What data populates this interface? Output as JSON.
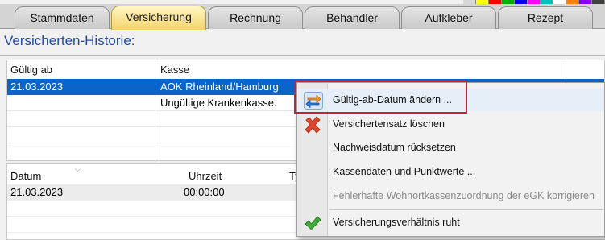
{
  "colors": {
    "accent_title": "#1f4ba8",
    "selection": "#0a64c9",
    "active_tab": "#f4d36a",
    "highlight_box": "#c0243c",
    "swatches": [
      "#d8d8d8",
      "#ffff00",
      "#ff0000",
      "#00b000",
      "#0000ff",
      "#ff00ff",
      "#00c0c0",
      "#ffffff",
      "#ff8000",
      "#8000ff",
      "#404040"
    ]
  },
  "tabs": [
    {
      "label": "Stammdaten",
      "active": false
    },
    {
      "label": "Versicherung",
      "active": true
    },
    {
      "label": "Rechnung",
      "active": false
    },
    {
      "label": "Behandler",
      "active": false
    },
    {
      "label": "Aufkleber",
      "active": false
    },
    {
      "label": "Rezept",
      "active": false
    }
  ],
  "title": "Versicherten-Historie:",
  "history_grid": {
    "columns": [
      "Gültig ab",
      "Kasse"
    ],
    "rows": [
      {
        "gueltig_ab": "21.03.2023",
        "kasse": "AOK Rheinland/Hamburg",
        "selected": true
      },
      {
        "gueltig_ab": "",
        "kasse": "Ungültige Krankenkasse.",
        "selected": false
      }
    ]
  },
  "detail_grid": {
    "columns": [
      "Datum",
      "Uhrzeit",
      "Ty"
    ],
    "rows": [
      {
        "datum": "21.03.2023",
        "uhrzeit": "00:00:00"
      }
    ]
  },
  "context_menu": {
    "items": [
      {
        "label": "Gültig-ab-Datum ändern ...",
        "icon": "swap-arrows-icon",
        "disabled": false,
        "highlighted": true
      },
      {
        "label": "Versichertensatz löschen",
        "icon": "red-x-icon",
        "disabled": false,
        "highlighted": false
      },
      {
        "label": "Nachweisdatum rücksetzen",
        "icon": "",
        "disabled": false,
        "highlighted": false
      },
      {
        "label": "Kassendaten und Punktwerte ...",
        "icon": "",
        "disabled": false,
        "highlighted": false
      },
      {
        "label": "Fehlerhafte Wohnortkassenzuordnung der eGK korrigieren",
        "icon": "",
        "disabled": true,
        "highlighted": false
      },
      {
        "label": "Versicherungsverhältnis ruht",
        "icon": "green-check-icon",
        "disabled": false,
        "highlighted": false
      }
    ]
  }
}
